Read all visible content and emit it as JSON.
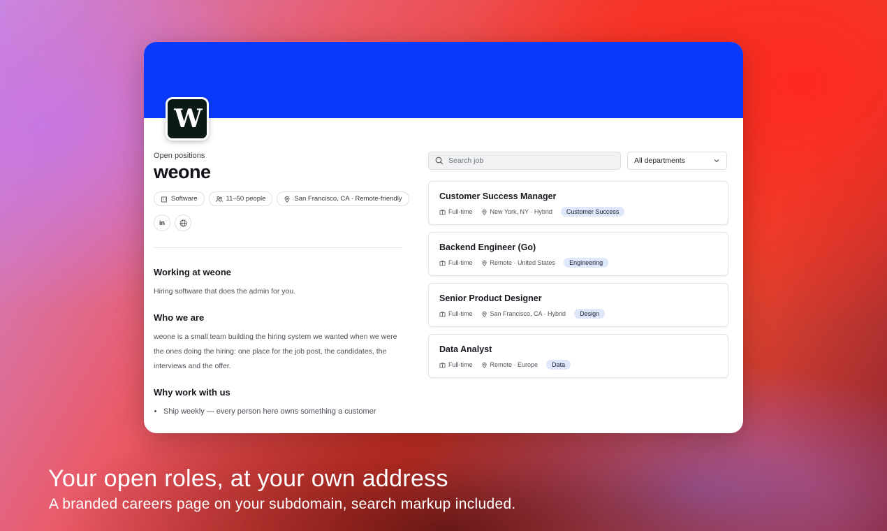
{
  "profile": {
    "eyebrow": "Open positions",
    "company_name": "weone",
    "logo_letter": "W",
    "chips": [
      {
        "icon": "building-icon",
        "label": "Software"
      },
      {
        "icon": "people-icon",
        "label": "11–50 people"
      },
      {
        "icon": "location-pin-icon",
        "label": "San Francisco, CA · Remote-friendly"
      }
    ],
    "social": [
      {
        "icon": "linkedin-icon",
        "label": "in"
      },
      {
        "icon": "globe-icon",
        "label": ""
      }
    ]
  },
  "about": {
    "working_title": "Working at weone",
    "working_text": "Hiring software that does the admin for you.",
    "who_title": "Who we are",
    "who_text": "weone is a small team building the hiring system we wanted when we were the ones doing the hiring: one place for the job post, the candidates, the interviews and the offer.",
    "why_title": "Why work with us",
    "why_items": [
      "Ship weekly — every person here owns something a customer"
    ]
  },
  "search": {
    "placeholder": "Search job"
  },
  "department_filter": {
    "selected": "All departments"
  },
  "jobs": [
    {
      "title": "Customer Success Manager",
      "type": "Full-time",
      "location": "New York, NY · Hybrid",
      "department": "Customer Success"
    },
    {
      "title": "Backend Engineer (Go)",
      "type": "Full-time",
      "location": "Remote · United States",
      "department": "Engineering"
    },
    {
      "title": "Senior Product Designer",
      "type": "Full-time",
      "location": "San Francisco, CA · Hybrid",
      "department": "Design"
    },
    {
      "title": "Data Analyst",
      "type": "Full-time",
      "location": "Remote · Europe",
      "department": "Data"
    }
  ],
  "marketing": {
    "headline": "Your open roles, at your own address",
    "subline": "A branded careers page on your subdomain, search markup included."
  },
  "colors": {
    "banner": "#0a3bfa",
    "tag_bg": "#dfe7fb"
  }
}
